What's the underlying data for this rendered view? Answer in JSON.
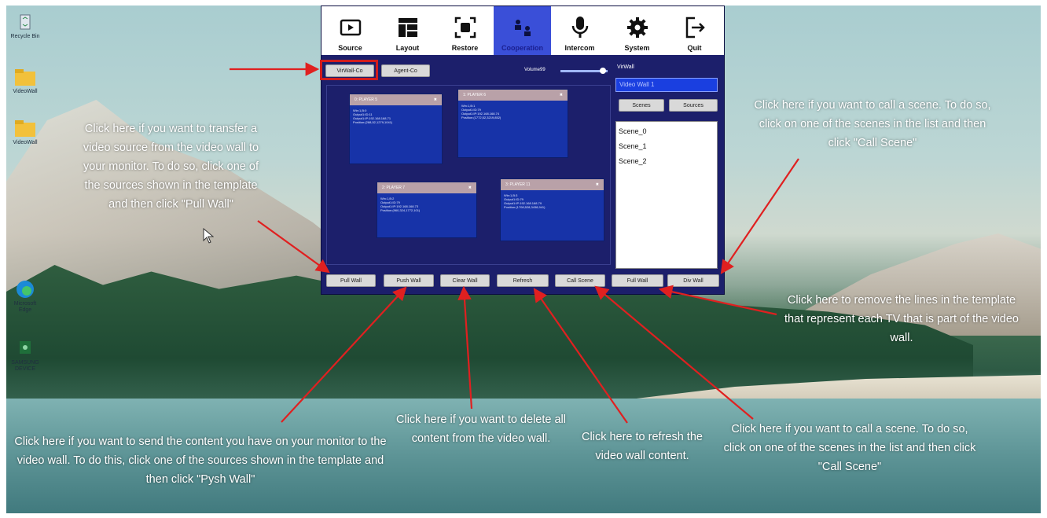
{
  "desktop": {
    "icons": [
      {
        "label": "Recycle Bin",
        "icon": "recycle-bin-icon"
      },
      {
        "label": "VideoWall",
        "icon": "folder-icon"
      },
      {
        "label": "VideoWall",
        "icon": "folder-icon"
      },
      {
        "label": "Microsoft Edge",
        "icon": "edge-icon"
      },
      {
        "label": "SAMSUNG DEVICE",
        "icon": "app-icon"
      }
    ]
  },
  "tabs": [
    {
      "label": "Source",
      "icon": "play-icon"
    },
    {
      "label": "Layout",
      "icon": "layout-icon"
    },
    {
      "label": "Restore",
      "icon": "restore-icon"
    },
    {
      "label": "Cooperation",
      "icon": "cooperation-icon"
    },
    {
      "label": "Intercom",
      "icon": "microphone-icon"
    },
    {
      "label": "System",
      "icon": "gear-icon"
    },
    {
      "label": "Quit",
      "icon": "quit-icon"
    }
  ],
  "toolbar": {
    "vwall_co": "VirWall-Co",
    "agent_co": "Agent-Co",
    "volume_label": "Volume99",
    "volume_level": 0.9
  },
  "right_panel": {
    "title": "VirWall",
    "wall_name": "Video Wall 1",
    "scenes_tab": "Scenes",
    "sources_tab": "Sources",
    "scenes": [
      "Scene_0",
      "Scene_1",
      "Scene_2"
    ]
  },
  "players": [
    {
      "title": "0: PLAYER 5",
      "info": "Win:1,B:0\nOutput1:ID:11\nOutput1:IP:192.168.168.71\nPosition:(288,52,1279,1041)"
    },
    {
      "title": "1: PLAYER 6",
      "info": "Win:1,B:1\nOutput1:ID:79\nOutput1:IP:192.168.168.74\nPosition:(1772,52,3219,852)"
    },
    {
      "title": "2: PLAYER 7",
      "info": "Win:1,B:2\nOutput1:ID:79\nOutput1:IP:192.168.168.73\nPosition:(960,324,1772,101)"
    },
    {
      "title": "3: PLAYER 11",
      "info": "Win:1,B:3\nOutput1:ID:79\nOutput1:IP:192.168.168.79\nPosition:(1708,528,3438,941)"
    }
  ],
  "bottom_buttons": {
    "pull_wall": "Pull Wall",
    "push_wall": "Push Wall",
    "clear_wall": "Clear Wall",
    "refresh": "Refresh",
    "call_scene": "Call Scene",
    "full_wall": "Full Wall",
    "div_wall": "Div Wall"
  },
  "annotations": {
    "pull": "Click here if you want to transfer a video source from the video wall to your monitor. To do so, click one of the sources shown in the template and then click \"Pull Wall\"",
    "scene_top": "Click here if you want to call a scene. To do so, click on one of the scenes in the list and then click \"Call Scene\"",
    "div": "Click here to remove the lines in the template that represent each TV that is part of the video wall.",
    "push": "Click here if you want to send the content you have on your monitor to the video wall. To do this, click one of the sources shown in the template and then click \"Pysh Wall\"",
    "clear": "Click here if you want to delete all content from the video wall.",
    "refresh": "Click here to refresh the video wall content.",
    "scene_bottom": "Click here if you want to call a scene. To do so, click on one of the scenes in the list and then click \"Call Scene\""
  },
  "colors": {
    "app_bg": "#1c1f6b",
    "active_tab": "#3a4fd8",
    "arrow": "#e02020",
    "player_bg": "#1733a8",
    "player_header": "#b9a1a8"
  }
}
